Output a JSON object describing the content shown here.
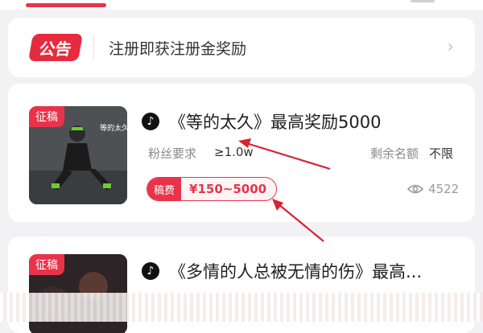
{
  "notice": {
    "badge": "公告",
    "text": "注册即获注册金奖励"
  },
  "task1": {
    "cover_tag": "征稿",
    "cover_art_text": "等的太久",
    "title": "《等的太久》最高奖励5000",
    "fan_req_label": "粉丝要求",
    "fan_req_value": "≥1.0w",
    "quota_label": "剩余名额",
    "quota_value": "不限",
    "fee_label": "稿费",
    "fee_value": "¥150~5000",
    "views": "4522"
  },
  "task2": {
    "cover_tag": "征稿",
    "title": "《多情的人总被无情的伤》最高..."
  },
  "colors": {
    "accent": "#e8334a",
    "arrow": "#d8222e"
  }
}
